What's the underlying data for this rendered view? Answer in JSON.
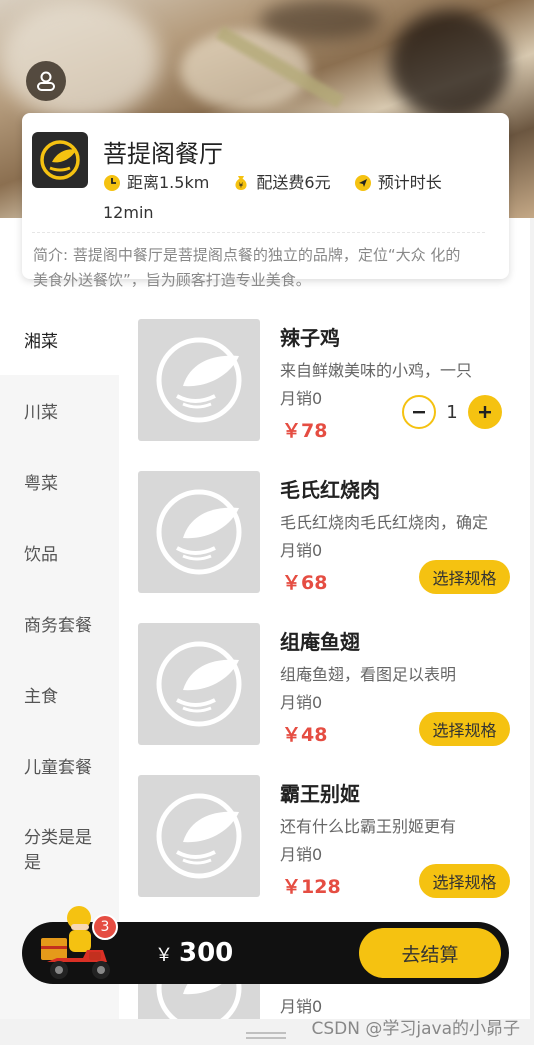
{
  "shop": {
    "name": "菩提阁餐厅",
    "distance": "距离1.5km",
    "delivery_fee": "配送费6元",
    "eta_label": "预计时长",
    "eta_value": "12min",
    "intro": "简介: 菩提阁中餐厅是菩提阁点餐的独立的品牌，定位“大众 化的美食外送餐饮”，旨为顾客打造专业美食。"
  },
  "categories": [
    {
      "label": "湘菜"
    },
    {
      "label": "川菜"
    },
    {
      "label": "粤菜"
    },
    {
      "label": "饮品"
    },
    {
      "label": "商务套餐"
    },
    {
      "label": "主食"
    },
    {
      "label": "儿童套餐"
    },
    {
      "label": "分类是是是"
    }
  ],
  "foods": [
    {
      "name": "辣子鸡",
      "desc": "来自鲜嫩美味的小鸡，一只",
      "sales": "月销0",
      "price": "￥78",
      "quantity": "1"
    },
    {
      "name": "毛氏红烧肉",
      "desc": "毛氏红烧肉毛氏红烧肉，确定",
      "sales": "月销0",
      "price": "￥68",
      "spec_label": "选择规格"
    },
    {
      "name": "组庵鱼翅",
      "desc": "组庵鱼翅，看图足以表明",
      "sales": "月销0",
      "price": "￥48",
      "spec_label": "选择规格"
    },
    {
      "name": "霸王别姬",
      "desc": "还有什么比霸王别姬更有",
      "sales": "月销0",
      "price": "￥128",
      "spec_label": "选择规格"
    },
    {
      "sales": "月销0"
    }
  ],
  "cart": {
    "badge": "3",
    "currency": "￥",
    "total": "300",
    "checkout_label": "去结算"
  },
  "watermark": "CSDN @学习java的小昴子",
  "colors": {
    "accent": "#f5c211",
    "price": "#e54d42",
    "cart_bar": "#111111"
  },
  "icons": {
    "user": "user-icon",
    "distance": "clock-icon",
    "fee": "money-bag-icon",
    "eta": "navigation-icon"
  }
}
